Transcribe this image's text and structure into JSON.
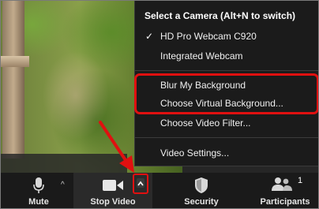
{
  "camera_menu": {
    "title": "Select a Camera (Alt+N to switch)",
    "cameras": [
      {
        "label": "HD Pro Webcam C920",
        "checked": true
      },
      {
        "label": "Integrated Webcam",
        "checked": false
      }
    ],
    "background_options": [
      {
        "label": "Blur My Background"
      },
      {
        "label": "Choose Virtual Background..."
      }
    ],
    "filter_option": "Choose Video Filter...",
    "settings_option": "Video Settings..."
  },
  "toolbar": {
    "mute_label": "Mute",
    "stop_video_label": "Stop Video",
    "security_label": "Security",
    "participants_label": "Participants",
    "participants_count": "1"
  },
  "annotation_colors": {
    "highlight": "#e01010",
    "arrow": "#e01010"
  },
  "icons": {
    "mute": "microphone-icon",
    "video": "video-camera-icon",
    "security": "shield-icon",
    "participants": "people-icon",
    "checkmark": "check-icon",
    "caret": "chevron-up-icon"
  }
}
